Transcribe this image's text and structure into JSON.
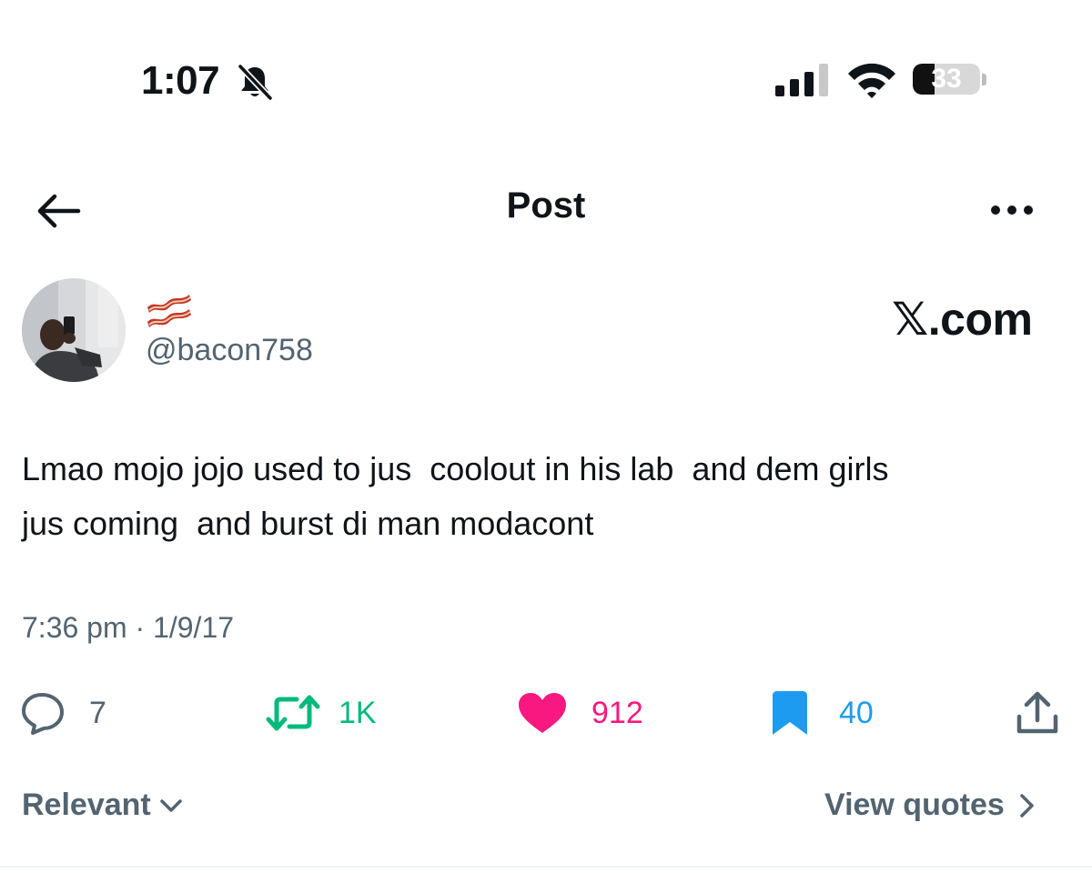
{
  "status_bar": {
    "time": "1:07",
    "battery": "33",
    "battery_level": 0.33
  },
  "header": {
    "title": "Post"
  },
  "author": {
    "handle": "@bacon758",
    "display_name_emoji": "bacon"
  },
  "watermark": "𝕏.com",
  "tweet": {
    "text": "Lmao mojo jojo used to jus  coolout in his lab  and dem girls\njus coming  and burst di man modacont",
    "timestamp": "7:36 pm · 1/9/17"
  },
  "actions": {
    "replies": "7",
    "reposts": "1K",
    "likes": "912",
    "bookmarks": "40"
  },
  "colors": {
    "text": "#0f1419",
    "secondary": "#536471",
    "repost": "#00ba7c",
    "like": "#f91880",
    "bookmark": "#1d9bf0"
  },
  "footer": {
    "sort_label": "Relevant",
    "quotes_label": "View quotes"
  }
}
